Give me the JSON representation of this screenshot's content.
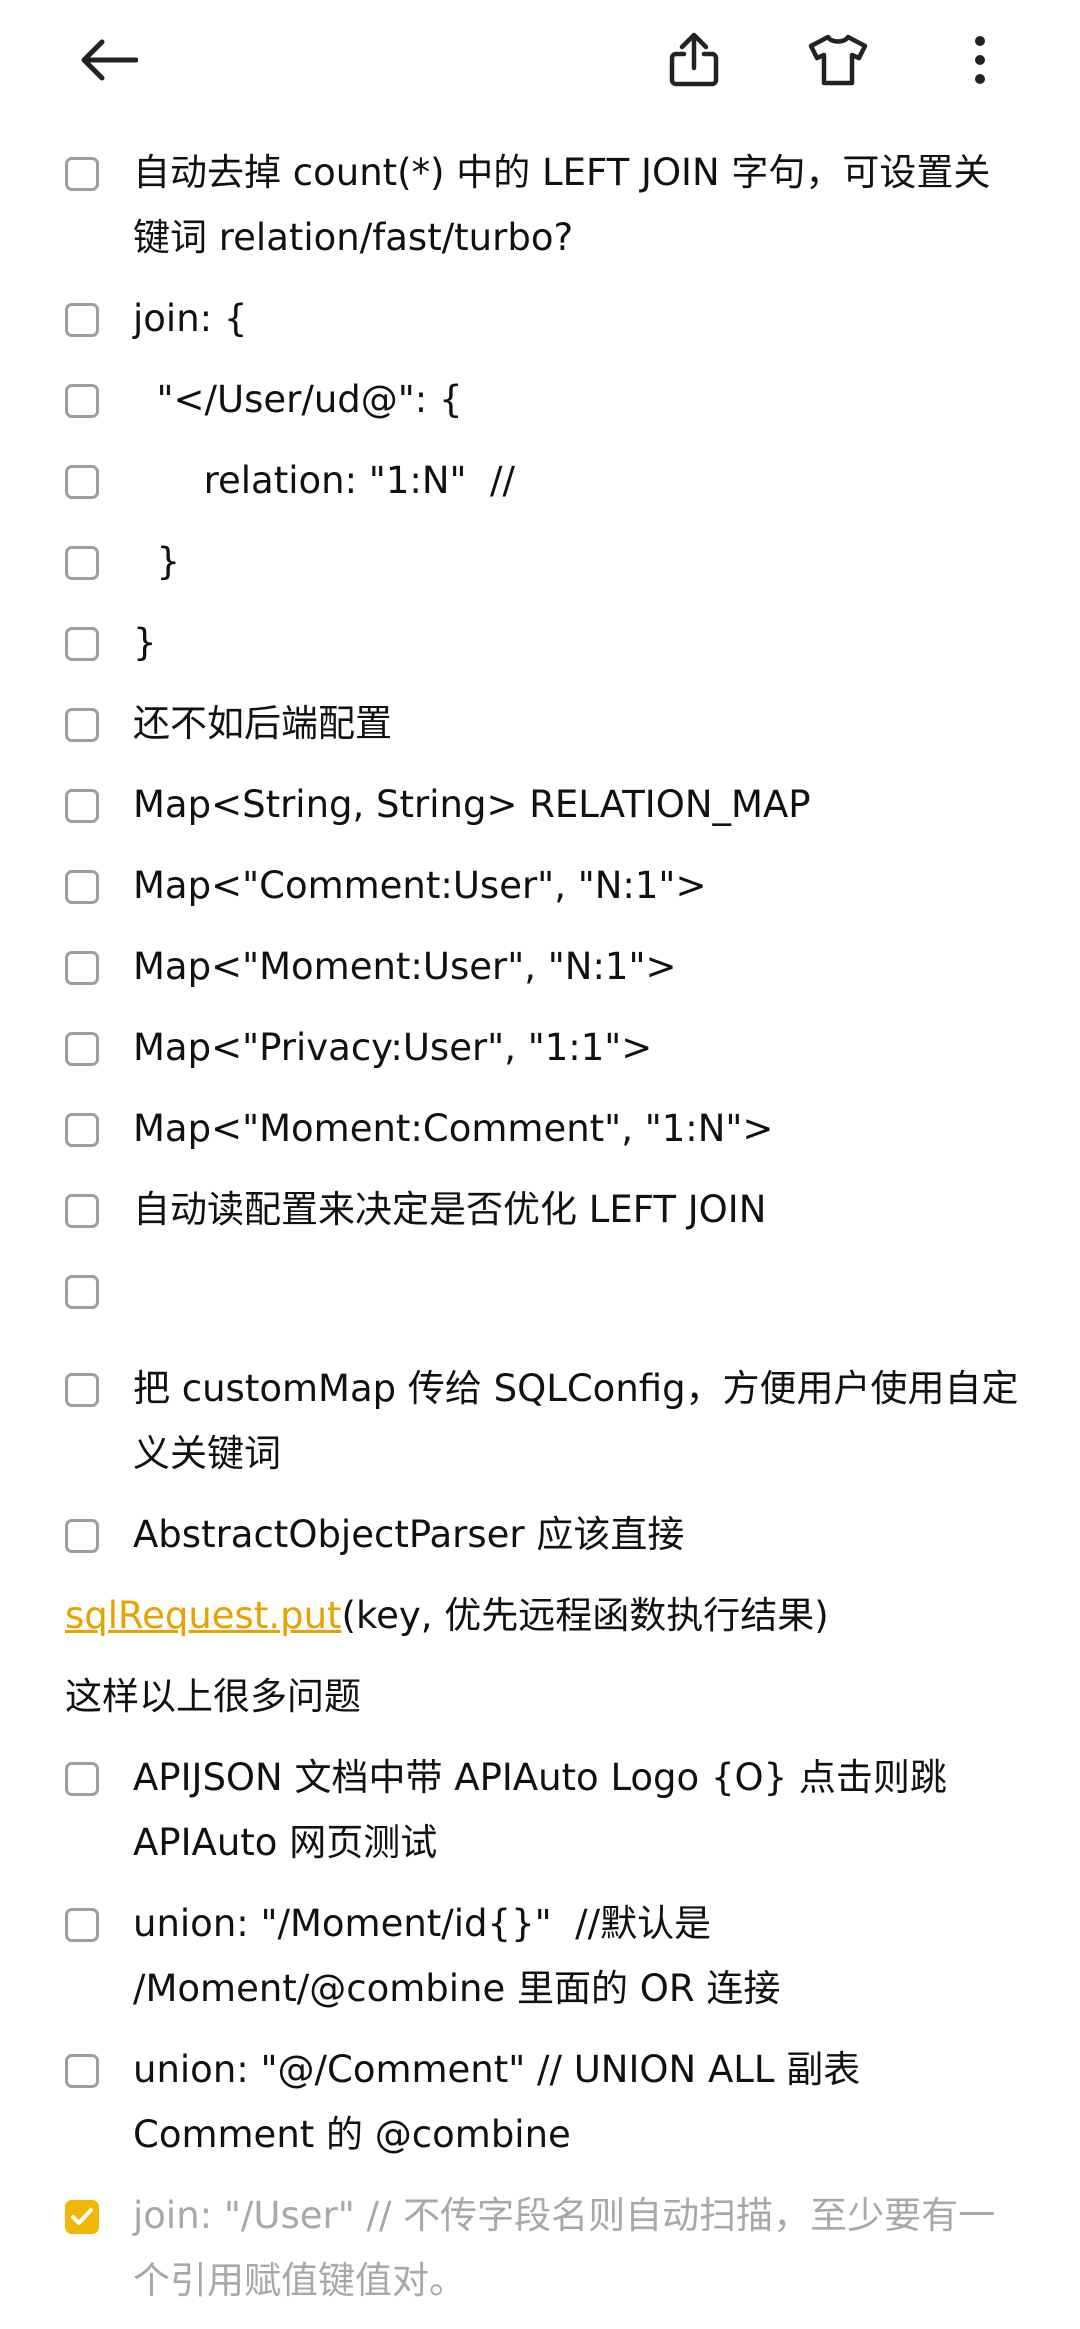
{
  "toolbar": {
    "back_icon": "arrow-left-icon",
    "share_icon": "share-icon",
    "theme_icon": "tshirt-icon",
    "more_icon": "more-vertical-icon"
  },
  "items": [
    {
      "text": "自动去掉 count(*) 中的 LEFT JOIN 字句，可设置关键词 relation/fast/turbo?",
      "checked": false
    },
    {
      "text": "join: {",
      "checked": false
    },
    {
      "text": "  \"</User/ud@\": {",
      "checked": false
    },
    {
      "text": "      relation: \"1:N\"  //",
      "checked": false
    },
    {
      "text": "  }",
      "checked": false
    },
    {
      "text": "}",
      "checked": false
    },
    {
      "text": "还不如后端配置",
      "checked": false
    },
    {
      "text": "Map<String, String> RELATION_MAP",
      "checked": false
    },
    {
      "text": "Map<\"Comment:User\", \"N:1\">",
      "checked": false
    },
    {
      "text": "Map<\"Moment:User\", \"N:1\">",
      "checked": false
    },
    {
      "text": "Map<\"Privacy:User\", \"1:1\">",
      "checked": false
    },
    {
      "text": "Map<\"Moment:Comment\", \"1:N\">",
      "checked": false
    },
    {
      "text": "自动读配置来决定是否优化 LEFT JOIN",
      "checked": false
    },
    {
      "text": "",
      "checked": false
    },
    {
      "text": "把 customMap 传给 SQLConfig，方便用户使用自定义关键词",
      "checked": false
    },
    {
      "text": "AbstractObjectParser 应该直接",
      "checked": false
    }
  ],
  "plain_line": {
    "link": "sqlRequest.put",
    "rest": "(key, 优先远程函数执行结果)"
  },
  "plain_line2": "这样以上很多问题",
  "items2": [
    {
      "text": "APIJSON 文档中带 APIAuto Logo {O} 点击则跳APIAuto 网页测试",
      "checked": false
    },
    {
      "text": "union: \"/Moment/id{}\"  //默认是 /Moment/@combine 里面的 OR 连接",
      "checked": false
    },
    {
      "text": "union: \"@/Comment\" // UNION ALL 副表Comment 的 @combine",
      "checked": false
    },
    {
      "text": "join: \"/User\" // 不传字段名则自动扫描，至少要有一个引用赋值键值对。",
      "checked": true
    }
  ],
  "colors": {
    "accent": "#f2b705",
    "link": "#e8a200",
    "checkbox_border": "#9e9e9e",
    "done_text": "#a8a8a8"
  }
}
